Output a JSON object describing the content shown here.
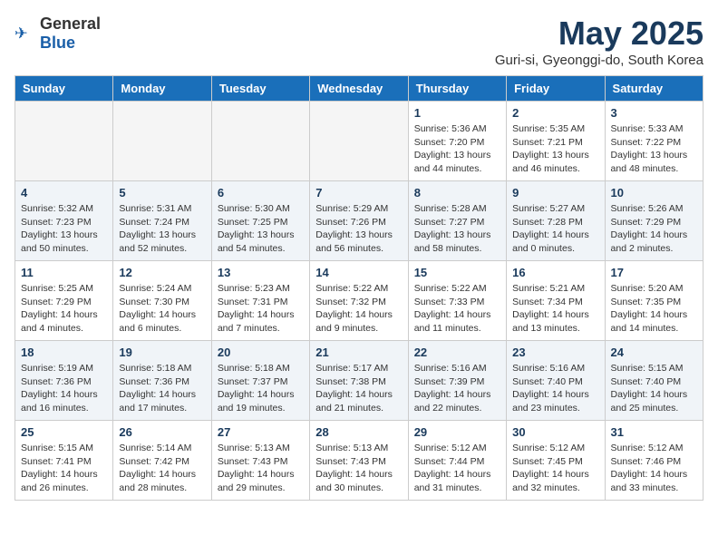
{
  "header": {
    "logo_general": "General",
    "logo_blue": "Blue",
    "title": "May 2025",
    "subtitle": "Guri-si, Gyeonggi-do, South Korea"
  },
  "days_of_week": [
    "Sunday",
    "Monday",
    "Tuesday",
    "Wednesday",
    "Thursday",
    "Friday",
    "Saturday"
  ],
  "weeks": [
    [
      {
        "day": "",
        "info": ""
      },
      {
        "day": "",
        "info": ""
      },
      {
        "day": "",
        "info": ""
      },
      {
        "day": "",
        "info": ""
      },
      {
        "day": "1",
        "info": "Sunrise: 5:36 AM\nSunset: 7:20 PM\nDaylight: 13 hours\nand 44 minutes."
      },
      {
        "day": "2",
        "info": "Sunrise: 5:35 AM\nSunset: 7:21 PM\nDaylight: 13 hours\nand 46 minutes."
      },
      {
        "day": "3",
        "info": "Sunrise: 5:33 AM\nSunset: 7:22 PM\nDaylight: 13 hours\nand 48 minutes."
      }
    ],
    [
      {
        "day": "4",
        "info": "Sunrise: 5:32 AM\nSunset: 7:23 PM\nDaylight: 13 hours\nand 50 minutes."
      },
      {
        "day": "5",
        "info": "Sunrise: 5:31 AM\nSunset: 7:24 PM\nDaylight: 13 hours\nand 52 minutes."
      },
      {
        "day": "6",
        "info": "Sunrise: 5:30 AM\nSunset: 7:25 PM\nDaylight: 13 hours\nand 54 minutes."
      },
      {
        "day": "7",
        "info": "Sunrise: 5:29 AM\nSunset: 7:26 PM\nDaylight: 13 hours\nand 56 minutes."
      },
      {
        "day": "8",
        "info": "Sunrise: 5:28 AM\nSunset: 7:27 PM\nDaylight: 13 hours\nand 58 minutes."
      },
      {
        "day": "9",
        "info": "Sunrise: 5:27 AM\nSunset: 7:28 PM\nDaylight: 14 hours\nand 0 minutes."
      },
      {
        "day": "10",
        "info": "Sunrise: 5:26 AM\nSunset: 7:29 PM\nDaylight: 14 hours\nand 2 minutes."
      }
    ],
    [
      {
        "day": "11",
        "info": "Sunrise: 5:25 AM\nSunset: 7:29 PM\nDaylight: 14 hours\nand 4 minutes."
      },
      {
        "day": "12",
        "info": "Sunrise: 5:24 AM\nSunset: 7:30 PM\nDaylight: 14 hours\nand 6 minutes."
      },
      {
        "day": "13",
        "info": "Sunrise: 5:23 AM\nSunset: 7:31 PM\nDaylight: 14 hours\nand 7 minutes."
      },
      {
        "day": "14",
        "info": "Sunrise: 5:22 AM\nSunset: 7:32 PM\nDaylight: 14 hours\nand 9 minutes."
      },
      {
        "day": "15",
        "info": "Sunrise: 5:22 AM\nSunset: 7:33 PM\nDaylight: 14 hours\nand 11 minutes."
      },
      {
        "day": "16",
        "info": "Sunrise: 5:21 AM\nSunset: 7:34 PM\nDaylight: 14 hours\nand 13 minutes."
      },
      {
        "day": "17",
        "info": "Sunrise: 5:20 AM\nSunset: 7:35 PM\nDaylight: 14 hours\nand 14 minutes."
      }
    ],
    [
      {
        "day": "18",
        "info": "Sunrise: 5:19 AM\nSunset: 7:36 PM\nDaylight: 14 hours\nand 16 minutes."
      },
      {
        "day": "19",
        "info": "Sunrise: 5:18 AM\nSunset: 7:36 PM\nDaylight: 14 hours\nand 17 minutes."
      },
      {
        "day": "20",
        "info": "Sunrise: 5:18 AM\nSunset: 7:37 PM\nDaylight: 14 hours\nand 19 minutes."
      },
      {
        "day": "21",
        "info": "Sunrise: 5:17 AM\nSunset: 7:38 PM\nDaylight: 14 hours\nand 21 minutes."
      },
      {
        "day": "22",
        "info": "Sunrise: 5:16 AM\nSunset: 7:39 PM\nDaylight: 14 hours\nand 22 minutes."
      },
      {
        "day": "23",
        "info": "Sunrise: 5:16 AM\nSunset: 7:40 PM\nDaylight: 14 hours\nand 23 minutes."
      },
      {
        "day": "24",
        "info": "Sunrise: 5:15 AM\nSunset: 7:40 PM\nDaylight: 14 hours\nand 25 minutes."
      }
    ],
    [
      {
        "day": "25",
        "info": "Sunrise: 5:15 AM\nSunset: 7:41 PM\nDaylight: 14 hours\nand 26 minutes."
      },
      {
        "day": "26",
        "info": "Sunrise: 5:14 AM\nSunset: 7:42 PM\nDaylight: 14 hours\nand 28 minutes."
      },
      {
        "day": "27",
        "info": "Sunrise: 5:13 AM\nSunset: 7:43 PM\nDaylight: 14 hours\nand 29 minutes."
      },
      {
        "day": "28",
        "info": "Sunrise: 5:13 AM\nSunset: 7:43 PM\nDaylight: 14 hours\nand 30 minutes."
      },
      {
        "day": "29",
        "info": "Sunrise: 5:12 AM\nSunset: 7:44 PM\nDaylight: 14 hours\nand 31 minutes."
      },
      {
        "day": "30",
        "info": "Sunrise: 5:12 AM\nSunset: 7:45 PM\nDaylight: 14 hours\nand 32 minutes."
      },
      {
        "day": "31",
        "info": "Sunrise: 5:12 AM\nSunset: 7:46 PM\nDaylight: 14 hours\nand 33 minutes."
      }
    ]
  ]
}
